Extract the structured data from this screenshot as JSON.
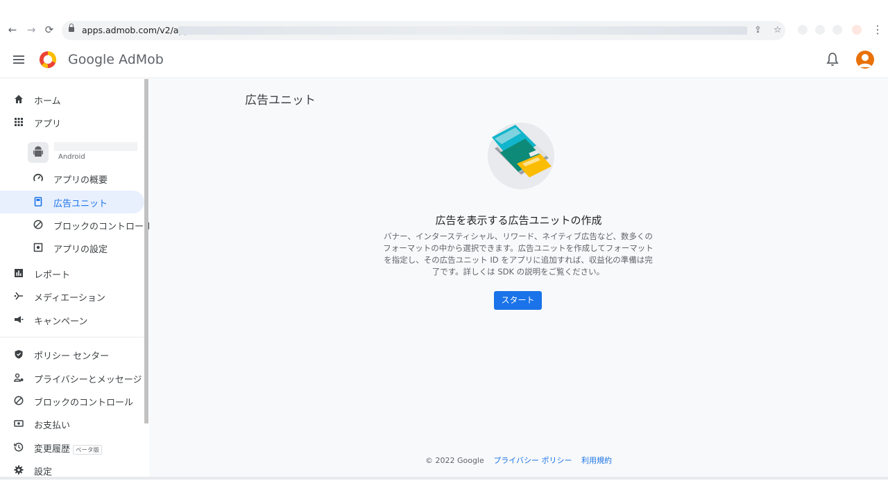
{
  "browser": {
    "url_host": "apps.admob.com/v2/apps/",
    "back_icon": "←",
    "forward_icon": "→",
    "reload_icon": "⟳",
    "share_icon": "⇪",
    "star_icon": "☆",
    "menu_icon": "⋮"
  },
  "header": {
    "brand": "Google AdMob"
  },
  "sidebar": {
    "items": [
      {
        "label": "ホーム",
        "icon": "home-icon"
      },
      {
        "label": "アプリ",
        "icon": "apps-grid-icon"
      },
      {
        "label": "アプリの概要",
        "icon": "speedometer-icon"
      },
      {
        "label": "広告ユニット",
        "icon": "ad-unit-icon"
      },
      {
        "label": "ブロックのコントロール",
        "icon": "block-icon"
      },
      {
        "label": "アプリの設定",
        "icon": "settings-box-icon"
      },
      {
        "label": "レポート",
        "icon": "bar-chart-icon"
      },
      {
        "label": "メディエーション",
        "icon": "mediation-icon"
      },
      {
        "label": "キャンペーン",
        "icon": "megaphone-icon"
      },
      {
        "label": "ポリシー センター",
        "icon": "shield-icon"
      },
      {
        "label": "プライバシーとメッセージ",
        "icon": "person-message-icon"
      },
      {
        "label": "ブロックのコントロール",
        "icon": "block-icon"
      },
      {
        "label": "お支払い",
        "icon": "payment-icon"
      },
      {
        "label": "変更履歴",
        "icon": "history-icon"
      },
      {
        "label": "設定",
        "icon": "gear-icon"
      }
    ],
    "app_platform": "Android",
    "beta_badge": "ベータ版"
  },
  "main": {
    "page_title": "広告ユニット",
    "heading": "広告を表示する広告ユニットの作成",
    "description": "バナー、インタースティシャル、リワード、ネイティブ広告など、数多くのフォーマットの中から選択できます。広告ユニットを作成してフォーマットを指定し、その広告ユニット ID をアプリに追加すれば、収益化の準備は完了です。詳しくは SDK の説明をご覧ください。",
    "start_button": "スタート"
  },
  "footer": {
    "copyright": "© 2022 Google",
    "privacy": "プライバシー ポリシー",
    "terms": "利用規約"
  },
  "colors": {
    "accent": "#1a73e8",
    "avatar": "#e8710a",
    "active_bg": "#e8f0fe"
  }
}
